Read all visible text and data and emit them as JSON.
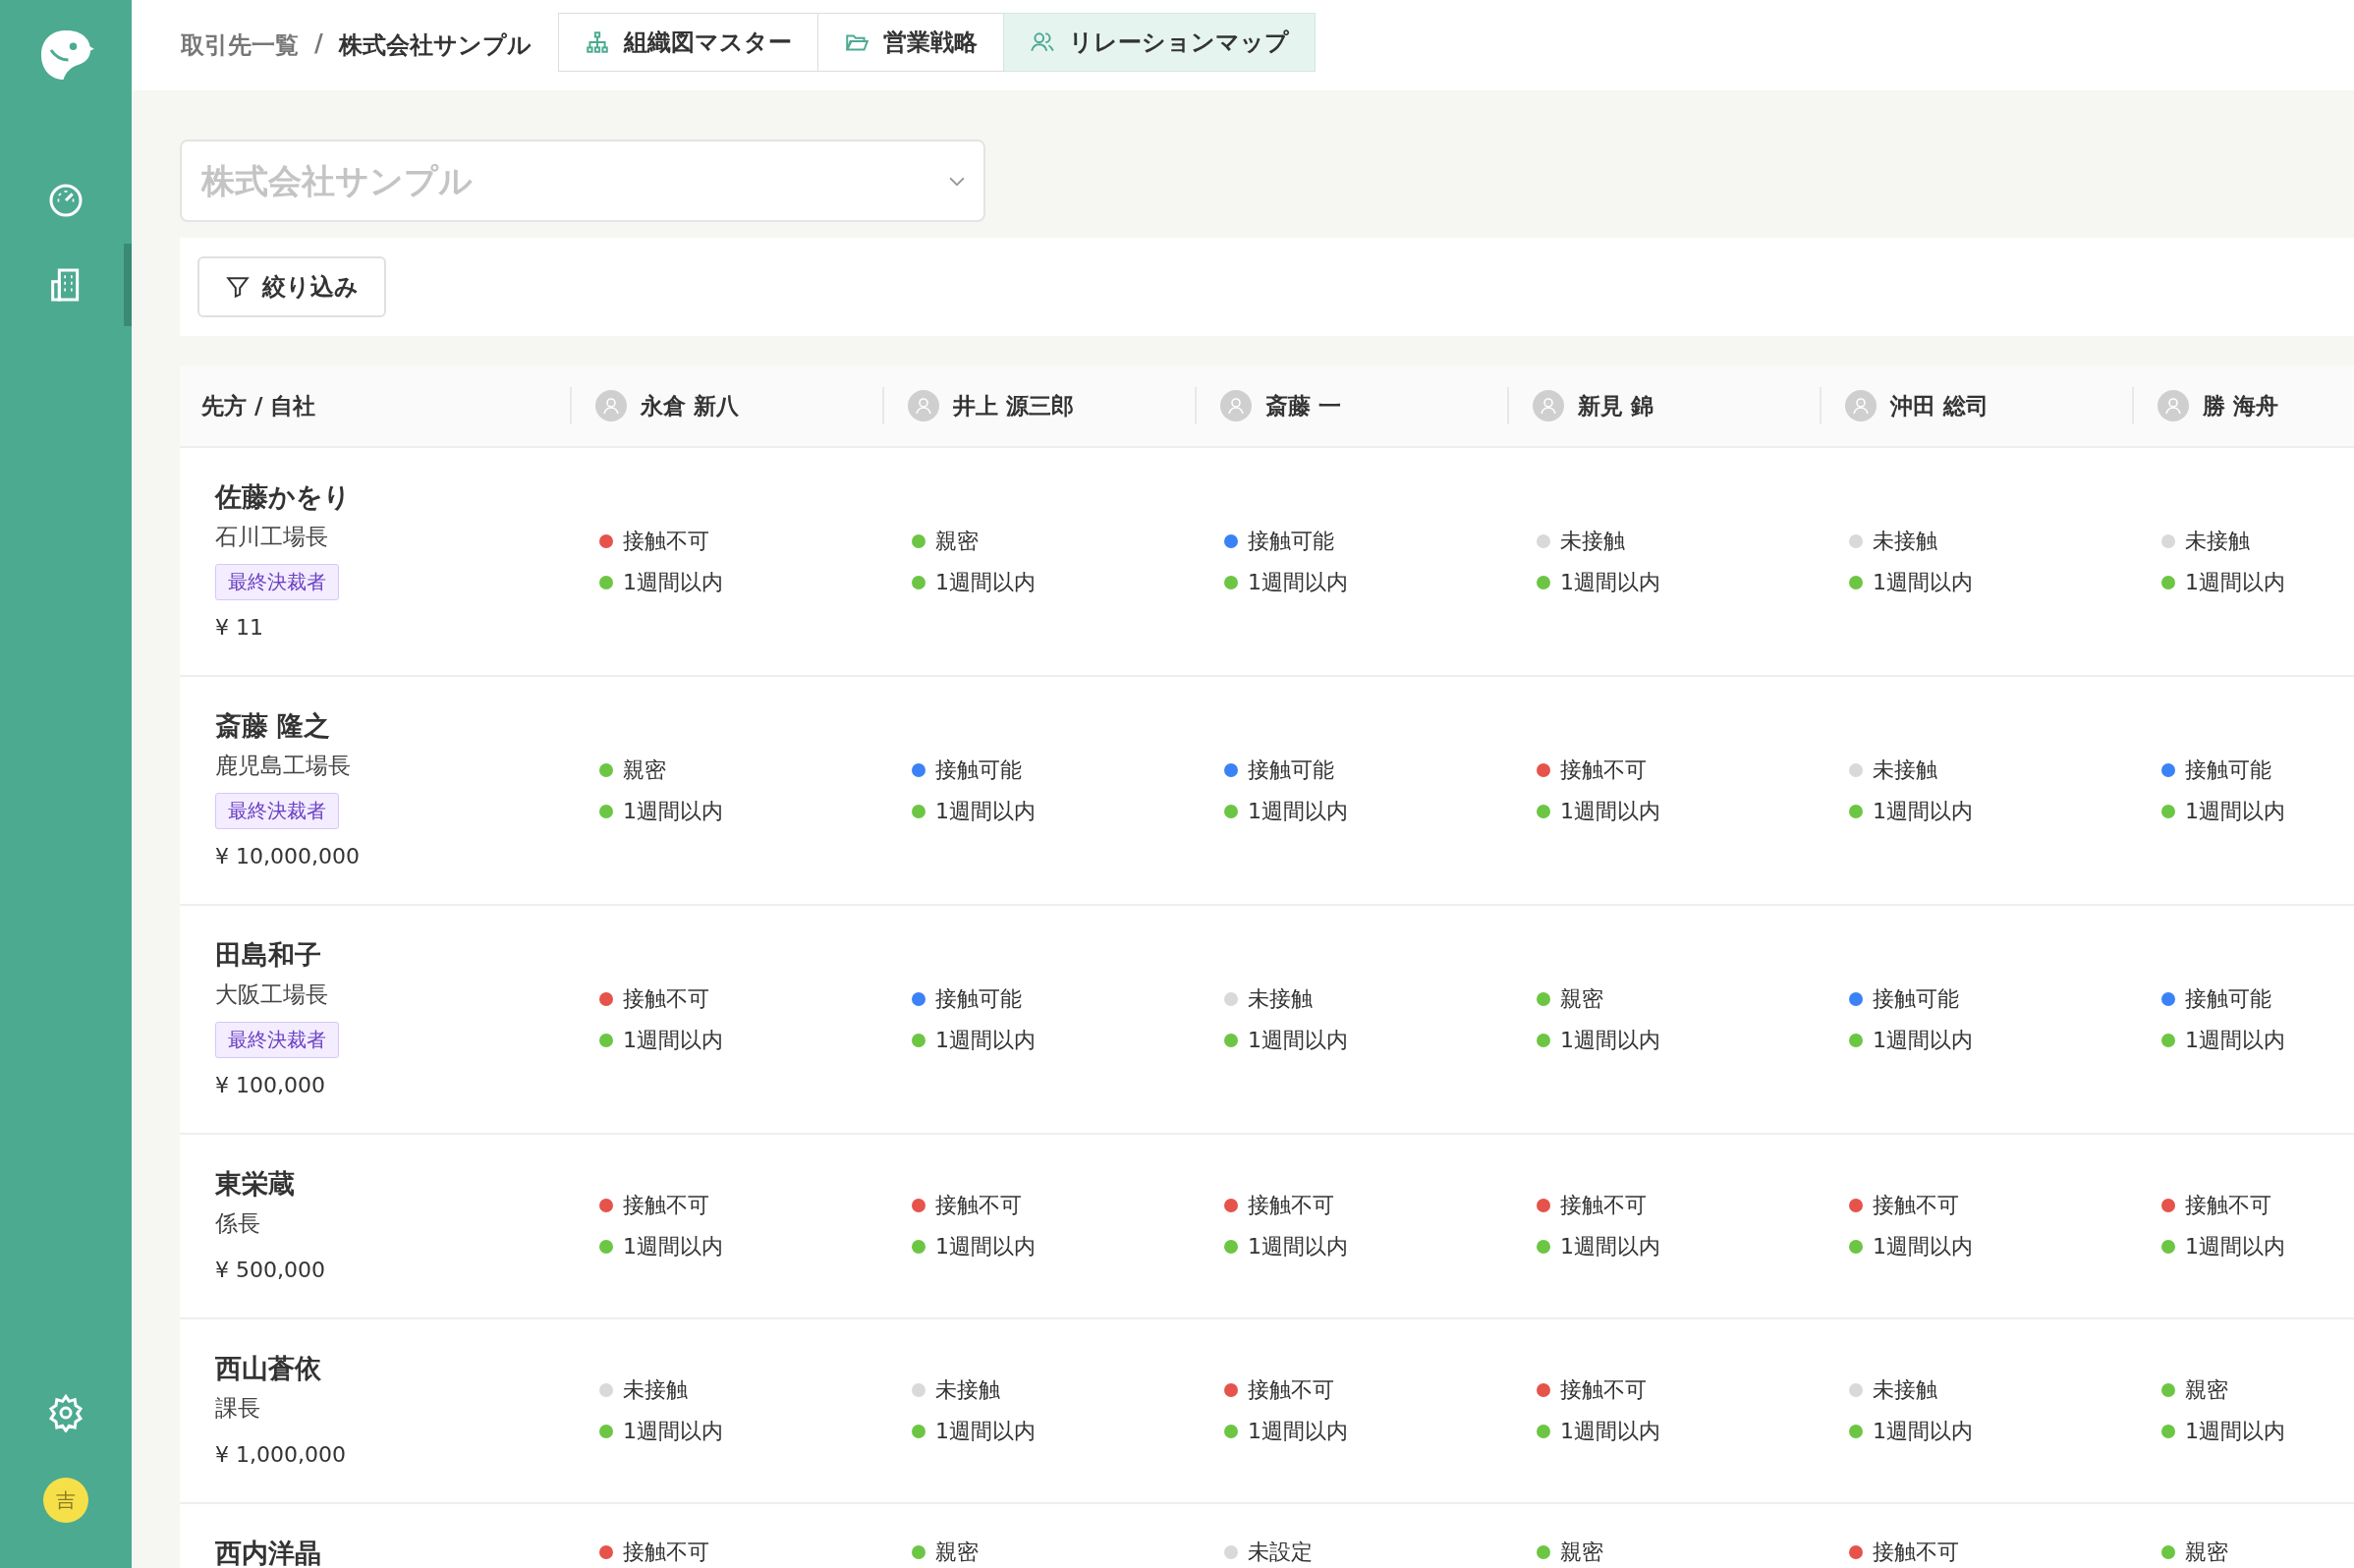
{
  "sidebar": {
    "items": [
      {
        "kind": "dashboard",
        "selected": false
      },
      {
        "kind": "building",
        "selected": true
      }
    ],
    "bottom": [
      {
        "kind": "settings"
      }
    ],
    "avatar": {
      "initial": "吉"
    }
  },
  "breadcrumb": [
    "取引先一覧",
    "/",
    "株式会社サンプル"
  ],
  "tabs": [
    {
      "kind": "org",
      "label": "組織図マスター",
      "selected": false
    },
    {
      "kind": "folder",
      "label": "営業戦略",
      "selected": false
    },
    {
      "kind": "people",
      "label": "リレーションマップ",
      "selected": true
    }
  ],
  "company_select": {
    "placeholder": "株式会社サンプル"
  },
  "filter_button": {
    "label": "絞り込み"
  },
  "table": {
    "corner": "先方 / 自社",
    "columns": [
      {
        "name": "永倉 新八"
      },
      {
        "name": "井上 源三郎"
      },
      {
        "name": "斎藤 一"
      },
      {
        "name": "新見 錦"
      },
      {
        "name": "沖田 総司"
      },
      {
        "name": "勝 海舟"
      }
    ],
    "rows": [
      {
        "name": "佐藤かをり",
        "title": "石川工場長",
        "badge": "最終決裁者",
        "amount": "¥ 11",
        "cells": [
          {
            "status": {
              "label": "接触不可",
              "color": "#e5534b"
            },
            "contact": {
              "label": "1週間以内",
              "color": "#6cc644"
            }
          },
          {
            "status": {
              "label": "親密",
              "color": "#6cc644"
            },
            "contact": {
              "label": "1週間以内",
              "color": "#6cc644"
            }
          },
          {
            "status": {
              "label": "接触可能",
              "color": "#3b82f6"
            },
            "contact": {
              "label": "1週間以内",
              "color": "#6cc644"
            }
          },
          {
            "status": {
              "label": "未接触",
              "color": "#d9d9d9"
            },
            "contact": {
              "label": "1週間以内",
              "color": "#6cc644"
            }
          },
          {
            "status": {
              "label": "未接触",
              "color": "#d9d9d9"
            },
            "contact": {
              "label": "1週間以内",
              "color": "#6cc644"
            }
          },
          {
            "status": {
              "label": "未接触",
              "color": "#d9d9d9"
            },
            "contact": {
              "label": "1週間以内",
              "color": "#6cc644"
            }
          }
        ]
      },
      {
        "name": "斎藤 隆之",
        "title": "鹿児島工場長",
        "badge": "最終決裁者",
        "amount": "¥ 10,000,000",
        "cells": [
          {
            "status": {
              "label": "親密",
              "color": "#6cc644"
            },
            "contact": {
              "label": "1週間以内",
              "color": "#6cc644"
            }
          },
          {
            "status": {
              "label": "接触可能",
              "color": "#3b82f6"
            },
            "contact": {
              "label": "1週間以内",
              "color": "#6cc644"
            }
          },
          {
            "status": {
              "label": "接触可能",
              "color": "#3b82f6"
            },
            "contact": {
              "label": "1週間以内",
              "color": "#6cc644"
            }
          },
          {
            "status": {
              "label": "接触不可",
              "color": "#e5534b"
            },
            "contact": {
              "label": "1週間以内",
              "color": "#6cc644"
            }
          },
          {
            "status": {
              "label": "未接触",
              "color": "#d9d9d9"
            },
            "contact": {
              "label": "1週間以内",
              "color": "#6cc644"
            }
          },
          {
            "status": {
              "label": "接触可能",
              "color": "#3b82f6"
            },
            "contact": {
              "label": "1週間以内",
              "color": "#6cc644"
            }
          }
        ]
      },
      {
        "name": "田島和子",
        "title": "大阪工場長",
        "badge": "最終決裁者",
        "amount": "¥ 100,000",
        "cells": [
          {
            "status": {
              "label": "接触不可",
              "color": "#e5534b"
            },
            "contact": {
              "label": "1週間以内",
              "color": "#6cc644"
            }
          },
          {
            "status": {
              "label": "接触可能",
              "color": "#3b82f6"
            },
            "contact": {
              "label": "1週間以内",
              "color": "#6cc644"
            }
          },
          {
            "status": {
              "label": "未接触",
              "color": "#d9d9d9"
            },
            "contact": {
              "label": "1週間以内",
              "color": "#6cc644"
            }
          },
          {
            "status": {
              "label": "親密",
              "color": "#6cc644"
            },
            "contact": {
              "label": "1週間以内",
              "color": "#6cc644"
            }
          },
          {
            "status": {
              "label": "接触可能",
              "color": "#3b82f6"
            },
            "contact": {
              "label": "1週間以内",
              "color": "#6cc644"
            }
          },
          {
            "status": {
              "label": "接触可能",
              "color": "#3b82f6"
            },
            "contact": {
              "label": "1週間以内",
              "color": "#6cc644"
            }
          }
        ]
      },
      {
        "name": "東栄蔵",
        "title": "係長",
        "amount": "¥ 500,000",
        "cells": [
          {
            "status": {
              "label": "接触不可",
              "color": "#e5534b"
            },
            "contact": {
              "label": "1週間以内",
              "color": "#6cc644"
            }
          },
          {
            "status": {
              "label": "接触不可",
              "color": "#e5534b"
            },
            "contact": {
              "label": "1週間以内",
              "color": "#6cc644"
            }
          },
          {
            "status": {
              "label": "接触不可",
              "color": "#e5534b"
            },
            "contact": {
              "label": "1週間以内",
              "color": "#6cc644"
            }
          },
          {
            "status": {
              "label": "接触不可",
              "color": "#e5534b"
            },
            "contact": {
              "label": "1週間以内",
              "color": "#6cc644"
            }
          },
          {
            "status": {
              "label": "接触不可",
              "color": "#e5534b"
            },
            "contact": {
              "label": "1週間以内",
              "color": "#6cc644"
            }
          },
          {
            "status": {
              "label": "接触不可",
              "color": "#e5534b"
            },
            "contact": {
              "label": "1週間以内",
              "color": "#6cc644"
            }
          }
        ]
      },
      {
        "name": "西山蒼依",
        "title": "課長",
        "amount": "¥ 1,000,000",
        "cells": [
          {
            "status": {
              "label": "未接触",
              "color": "#d9d9d9"
            },
            "contact": {
              "label": "1週間以内",
              "color": "#6cc644"
            }
          },
          {
            "status": {
              "label": "未接触",
              "color": "#d9d9d9"
            },
            "contact": {
              "label": "1週間以内",
              "color": "#6cc644"
            }
          },
          {
            "status": {
              "label": "接触不可",
              "color": "#e5534b"
            },
            "contact": {
              "label": "1週間以内",
              "color": "#6cc644"
            }
          },
          {
            "status": {
              "label": "接触不可",
              "color": "#e5534b"
            },
            "contact": {
              "label": "1週間以内",
              "color": "#6cc644"
            }
          },
          {
            "status": {
              "label": "未接触",
              "color": "#d9d9d9"
            },
            "contact": {
              "label": "1週間以内",
              "color": "#6cc644"
            }
          },
          {
            "status": {
              "label": "親密",
              "color": "#6cc644"
            },
            "contact": {
              "label": "1週間以内",
              "color": "#6cc644"
            }
          }
        ]
      },
      {
        "name": "西内洋晶",
        "cells": [
          {
            "status": {
              "label": "接触不可",
              "color": "#e5534b"
            }
          },
          {
            "status": {
              "label": "親密",
              "color": "#6cc644"
            }
          },
          {
            "status": {
              "label": "未設定",
              "color": "#d9d9d9"
            }
          },
          {
            "status": {
              "label": "親密",
              "color": "#6cc644"
            }
          },
          {
            "status": {
              "label": "接触不可",
              "color": "#e5534b"
            }
          },
          {
            "status": {
              "label": "親密",
              "color": "#6cc644"
            }
          }
        ]
      }
    ]
  }
}
